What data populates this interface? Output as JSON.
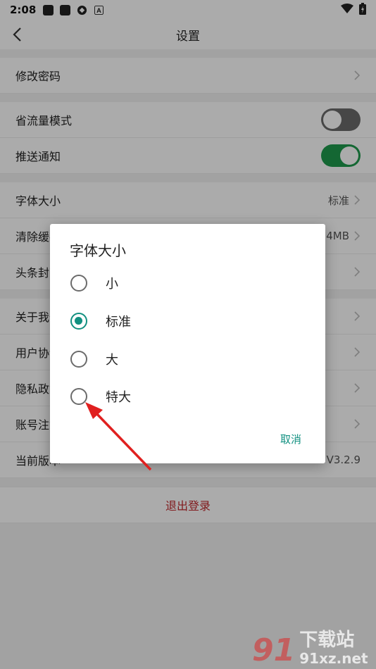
{
  "status_bar": {
    "time": "2:08",
    "icons": [
      "notification-square-icon",
      "notification-square-icon",
      "app-icon",
      "a-icon"
    ],
    "right_icons": [
      "wifi-icon",
      "battery-icon"
    ]
  },
  "header": {
    "title": "设置",
    "back_icon": "chevron-left-icon"
  },
  "settings": {
    "change_password": "修改密码",
    "data_saver": {
      "label": "省流量模式",
      "enabled": false
    },
    "push_notify": {
      "label": "推送通知",
      "enabled": true
    },
    "font_size": {
      "label": "字体大小",
      "value": "标准"
    },
    "clear_cache": {
      "label": "清除缓存",
      "value": "54MB"
    },
    "headline_cover": {
      "label": "头条封面"
    },
    "about": {
      "label": "关于我们"
    },
    "user_agreement": {
      "label": "用户协议"
    },
    "privacy": {
      "label": "隐私政策"
    },
    "account_cancel": {
      "label": "账号注销"
    },
    "version": {
      "label": "当前版本",
      "value": "V3.2.9"
    },
    "logout": "退出登录"
  },
  "dialog": {
    "title": "字体大小",
    "options": [
      {
        "label": "小",
        "selected": false
      },
      {
        "label": "标准",
        "selected": true
      },
      {
        "label": "大",
        "selected": false
      },
      {
        "label": "特大",
        "selected": false
      }
    ],
    "cancel": "取消"
  },
  "colors": {
    "accent": "#119080",
    "toggle_on": "#1f9a4d",
    "logout": "#c0282c",
    "annotation_arrow": "#e0201f"
  },
  "watermark": {
    "logo": "91",
    "cn": "下载站",
    "en": "91xz.net"
  }
}
